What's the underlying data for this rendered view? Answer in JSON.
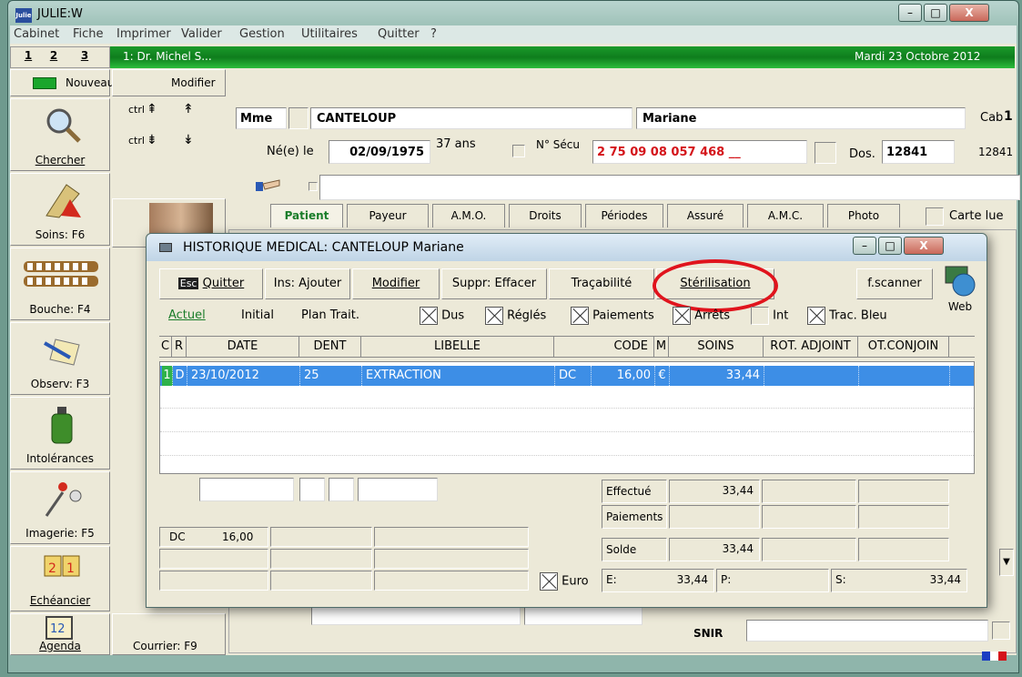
{
  "window": {
    "app_logo": "Julie",
    "title": "JULIE:W",
    "controls": [
      "–",
      "□",
      "X"
    ]
  },
  "menu": [
    "Cabinet",
    "Fiche",
    "Imprimer",
    "Valider",
    "Gestion",
    "Utilitaires",
    "Quitter",
    "?"
  ],
  "header_bar": {
    "tabs": [
      "1",
      "2",
      "3"
    ],
    "doctor": "1: Dr. Michel S...",
    "date": "Mardi 23 Octobre 2012"
  },
  "top_buttons": {
    "new": "Nouveau",
    "modify": "Modifier",
    "ctrl1": "ctrl",
    "ctrl2": "ctrl"
  },
  "patient": {
    "civility": "Mme",
    "last_name": "CANTELOUP",
    "first_name": "Mariane",
    "cab_label": "Cab",
    "cab_value": "1",
    "birth_label": "Né(e) le",
    "birth_date": "02/09/1975",
    "age": "37 ans",
    "secu_label": "N° Sécu",
    "secu": "2 75 09 08 057 468 __",
    "dos_label": "Dos.",
    "dos_value": "12841",
    "dos_value2": "12841"
  },
  "patient_tabs": [
    "Patient",
    "Payeur",
    "A.M.O.",
    "Droits",
    "Périodes",
    "Assuré",
    "A.M.C.",
    "Photo"
  ],
  "carte_lue": "Carte lue",
  "sidebar": [
    {
      "label": "Chercher",
      "icon": "magnifier-icon"
    },
    {
      "label": "Soins: F6",
      "icon": "notebook-icon"
    },
    {
      "label": "Bouche: F4",
      "icon": "teeth-icon"
    },
    {
      "label": "Observ: F3",
      "icon": "pen-icon"
    },
    {
      "label": "Intolérances",
      "icon": "bottle-icon"
    },
    {
      "label": "Imagerie: F5",
      "icon": "radiology-icon"
    },
    {
      "label": "Echéancier",
      "icon": "calendar-icon"
    },
    {
      "label": "Agenda",
      "icon": "agenda-icon"
    }
  ],
  "second_col": {
    "courrier": "Courrier: F9"
  },
  "bottom": {
    "snir": "SNIR"
  },
  "dialog": {
    "title": "HISTORIQUE MEDICAL: CANTELOUP Mariane",
    "toolbar": {
      "esc_key": "Esc",
      "quit": "Quitter",
      "ins": "Ins: Ajouter",
      "modify": "Modifier",
      "delete": "Suppr: Effacer",
      "tracability": "Traçabilité",
      "sterilisation": "Stérilisation",
      "scanner": "f.scanner",
      "web": "Web"
    },
    "subtabs": [
      "Actuel",
      "Initial",
      "Plan Trait."
    ],
    "filters": [
      "Dus",
      "Réglés",
      "Paiements",
      "Arrêts",
      "Int",
      "Trac. Bleu"
    ],
    "columns": [
      "C",
      "R",
      "DATE",
      "DENT",
      "LIBELLE",
      "CODE",
      "M",
      "SOINS",
      "ROT. ADJOINT",
      "OT.CONJOIN"
    ],
    "rows": [
      {
        "c": "1",
        "r": "D",
        "date": "23/10/2012",
        "dent": "25",
        "libelle": "EXTRACTION",
        "code": "DC",
        "coef": "16,00",
        "m": "€",
        "soins": "33,44"
      }
    ],
    "totals": {
      "effectue_label": "Effectué",
      "effectue": "33,44",
      "paiements_label": "Paiements",
      "solde_label": "Solde",
      "solde": "33,44",
      "dc_code": "DC",
      "dc_value": "16,00",
      "euro_label": "Euro",
      "e_label": "E:",
      "e_value": "33,44",
      "p_label": "P:",
      "s_label": "S:",
      "s_value": "33,44"
    }
  },
  "colors": {
    "accent_green": "#1b9a2a",
    "selection_blue": "#3d8ee6",
    "secu_red": "#d4141a",
    "annotation_red": "#e0141d"
  }
}
